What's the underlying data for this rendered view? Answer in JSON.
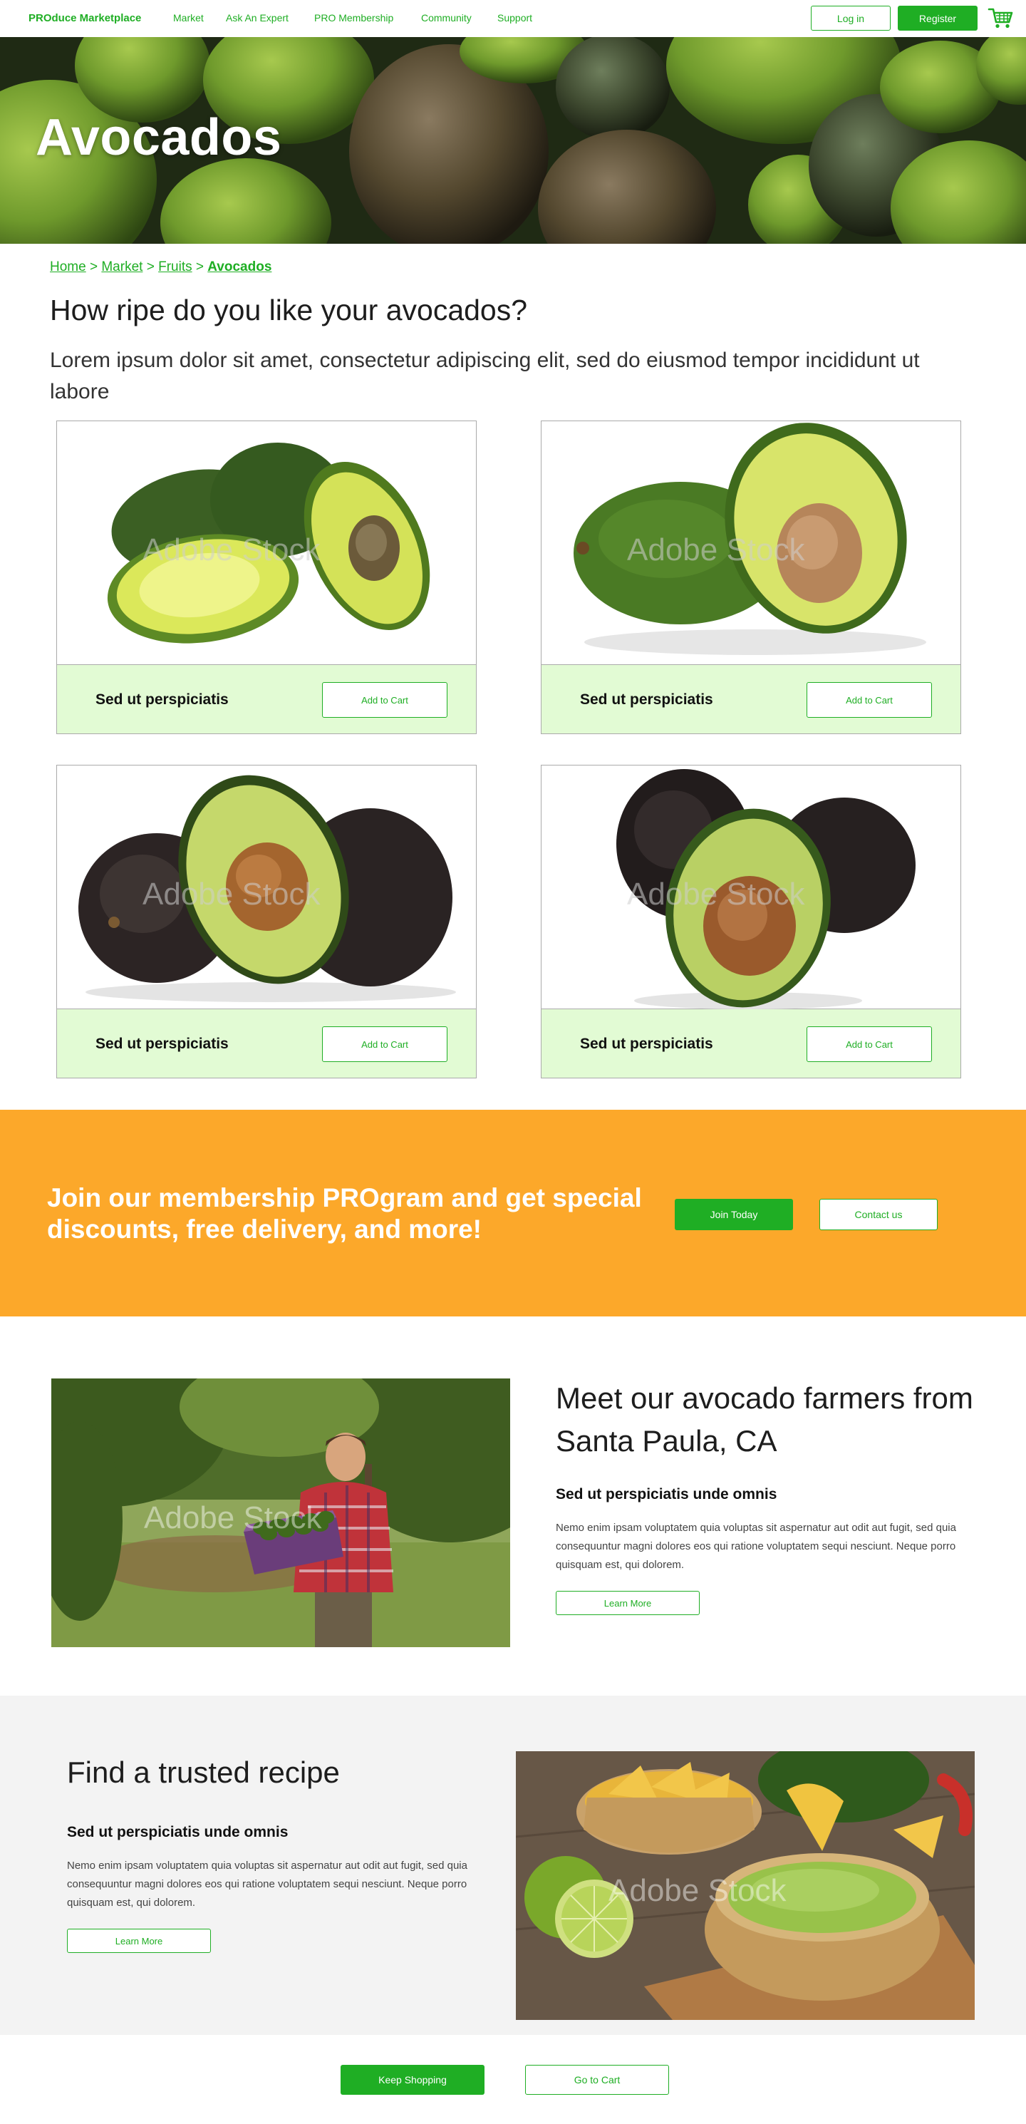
{
  "nav": {
    "brand": "PROduce Marketplace",
    "links": [
      "Market",
      "Ask An Expert",
      "PRO Membership",
      "Community",
      "Support"
    ],
    "login_label": "Log in",
    "register_label": "Register",
    "cart_icon": "shopping-cart-icon"
  },
  "hero": {
    "title": "Avocados"
  },
  "breadcrumb": {
    "items": [
      "Home",
      "Market",
      "Fruits"
    ],
    "current": "Avocados",
    "separator": ">"
  },
  "intro": {
    "heading": "How ripe do you like your avocados?",
    "lead": "Lorem ipsum dolor sit amet, consectetur adipiscing elit, sed do eiusmod tempor incididunt ut labore"
  },
  "products": [
    {
      "name": "Sed ut perspiciatis",
      "button": "Add to Cart",
      "watermark": "Adobe Stock",
      "ripeness": "green"
    },
    {
      "name": "Sed ut perspiciatis",
      "button": "Add to Cart",
      "watermark": "Adobe Stock",
      "ripeness": "green-ripe"
    },
    {
      "name": "Sed ut perspiciatis",
      "button": "Add to Cart",
      "watermark": "Adobe Stock",
      "ripeness": "dark"
    },
    {
      "name": "Sed ut perspiciatis",
      "button": "Add to Cart",
      "watermark": "Adobe Stock",
      "ripeness": "very-dark"
    }
  ],
  "membership": {
    "text": "Join our membership PROgram and get special discounts, free delivery, and more!",
    "join_label": "Join Today",
    "contact_label": "Contact us"
  },
  "farmers": {
    "title": "Meet our avocado farmers from Santa Paula, CA",
    "subtitle": "Sed ut perspiciatis unde omnis",
    "body": "Nemo enim ipsam voluptatem quia voluptas sit aspernatur aut odit aut fugit, sed quia consequuntur magni dolores eos qui ratione voluptatem sequi nesciunt. Neque porro quisquam est, qui dolorem.",
    "button": "Learn More",
    "watermark": "Adobe Stock"
  },
  "recipe": {
    "title": "Find a trusted recipe",
    "subtitle": "Sed ut perspiciatis unde omnis",
    "body": "Nemo enim ipsam voluptatem quia voluptas sit aspernatur aut odit aut fugit, sed quia consequuntur magni dolores eos qui ratione voluptatem sequi nesciunt. Neque porro quisquam est, qui dolorem.",
    "button": "Learn More",
    "watermark": "Adobe Stock"
  },
  "footer_actions": {
    "keep_shopping": "Keep Shopping",
    "go_to_cart": "Go to Cart"
  },
  "colors": {
    "brand_green": "#1fae24",
    "card_footer": "#e2fbd4",
    "banner_orange": "#fca82a",
    "recipe_bg": "#f3f3f3"
  }
}
